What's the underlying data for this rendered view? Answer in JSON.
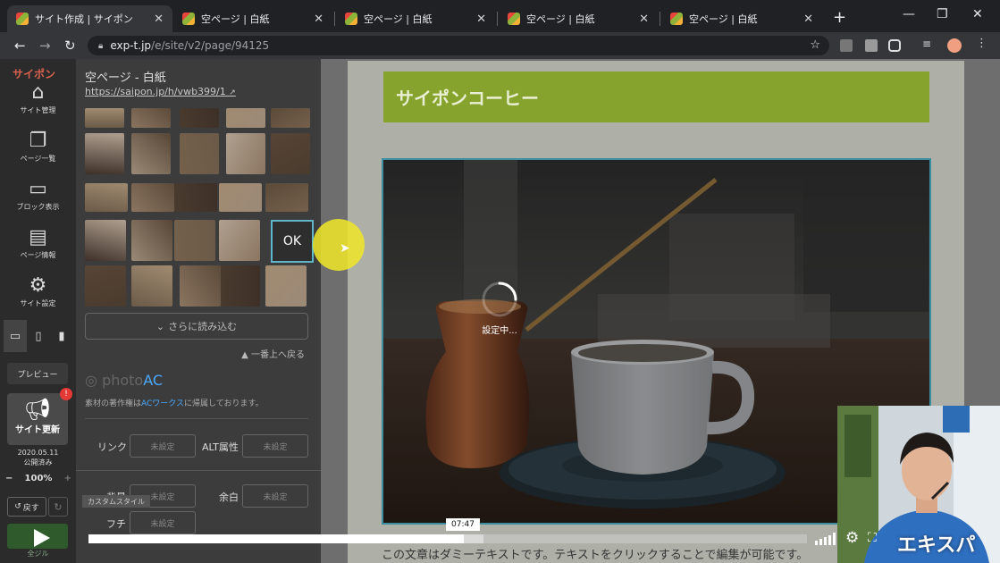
{
  "browser": {
    "tabs": [
      {
        "title": "サイト作成 | サイポン",
        "active": true
      },
      {
        "title": "空ページ | 白紙",
        "active": false
      },
      {
        "title": "空ページ | 白紙",
        "active": false
      },
      {
        "title": "空ページ | 白紙",
        "active": false
      },
      {
        "title": "空ページ | 白紙",
        "active": false
      }
    ],
    "address_host": "exp-t.jp",
    "address_path": "/e/site/v2/page/94125"
  },
  "rail": {
    "brand": "サイポン",
    "items": [
      {
        "icon": "home-icon",
        "label": "サイト管理"
      },
      {
        "icon": "pages-icon",
        "label": "ページ一覧"
      },
      {
        "icon": "blocks-icon",
        "label": "ブロック表示"
      },
      {
        "icon": "document-icon",
        "label": "ページ情報"
      },
      {
        "icon": "gear-icon",
        "label": "サイト設定"
      }
    ],
    "preview_label": "プレビュー",
    "update_label": "サイト更新",
    "update_badge": "!",
    "publish_date": "2020.05.11",
    "publish_status": "公開済み",
    "zoom": "100%",
    "undo_label": "戻す",
    "green_label": "全ジル"
  },
  "panel": {
    "title": "空ページ - 白紙",
    "url": "https://saipon.jp/h/vwb399/1",
    "ok_label": "OK",
    "load_more": "さらに読み込む",
    "back_to_top": "▲ 一番上へ戻る",
    "photoac_prefix": "photo",
    "photoac_suffix": "AC",
    "credit_prefix": "素材の著作権は",
    "credit_link": "ACワークス",
    "credit_suffix": "に帰属しております。",
    "link_label": "リンク",
    "alt_label": "ALT属性",
    "bg_label": "背景",
    "margin_label": "余白",
    "border_label": "フチ",
    "unset": "未設定",
    "custom_style": "カスタムスタイル"
  },
  "editor": {
    "banner_text": "サイポンコーヒー",
    "loading_text": "設定中...",
    "body_text": "この文章はダミーテキストです。テキストをクリックすることで編集が可能です。"
  },
  "video": {
    "time": "07:47",
    "played_fraction": 0.522,
    "buffered_fraction": 0.55,
    "brand": "エキスパ"
  }
}
